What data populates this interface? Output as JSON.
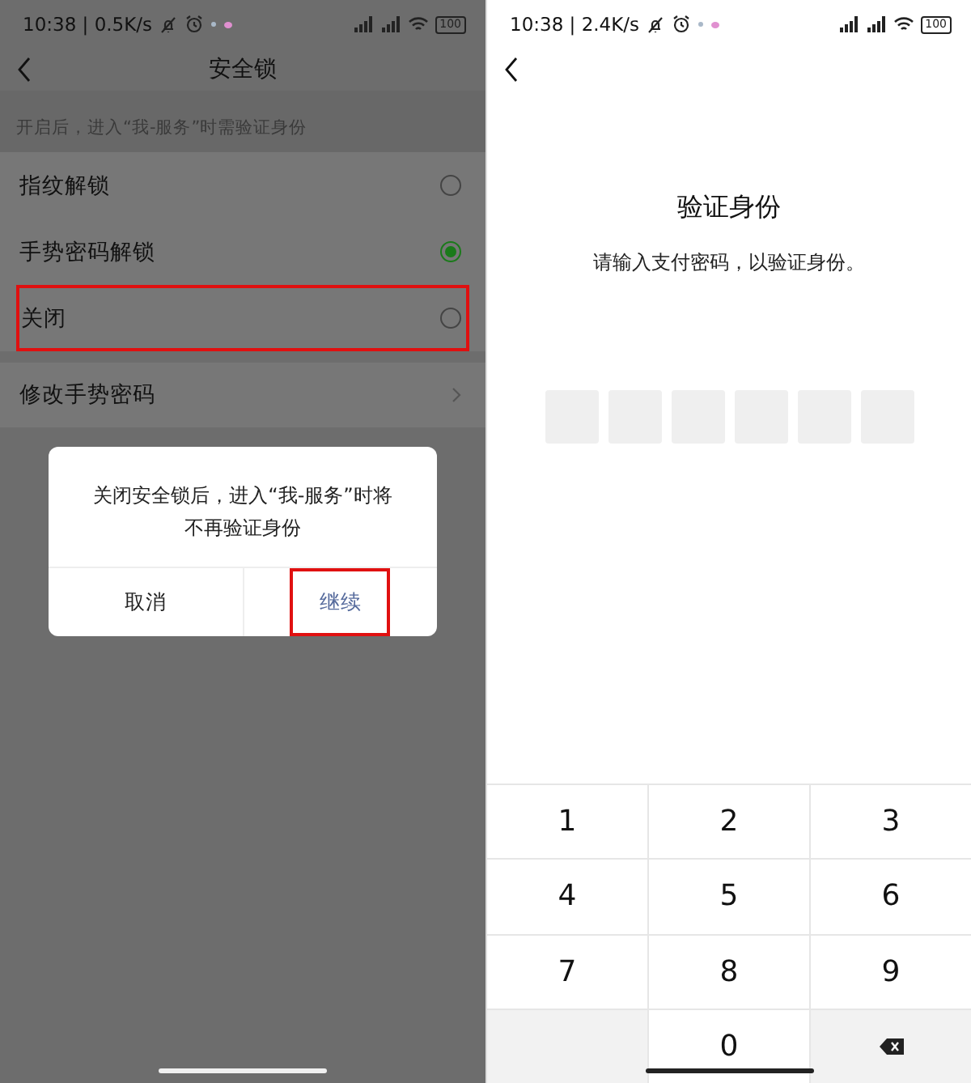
{
  "left_screen": {
    "status_bar": {
      "time": "10:38 | 0.5K/s",
      "battery": "100"
    },
    "title": "安全锁",
    "hint": "开启后，进入“我-服务”时需验证身份",
    "options": [
      {
        "kind": "radio",
        "label": "指纹解锁",
        "selected": false,
        "highlighted": false
      },
      {
        "kind": "radio",
        "label": "手势密码解锁",
        "selected": true,
        "highlighted": false
      },
      {
        "kind": "radio",
        "label": "关闭",
        "selected": false,
        "highlighted": true
      }
    ],
    "links": [
      {
        "label": "修改手势密码"
      }
    ],
    "dialog": {
      "message": "关闭安全锁后，进入“我-服务”时将不再验证身份",
      "buttons": [
        {
          "label": "取消",
          "kind": "cancel",
          "highlighted": false
        },
        {
          "label": "继续",
          "kind": "confirm",
          "highlighted": true
        }
      ]
    }
  },
  "right_screen": {
    "status_bar": {
      "time": "10:38 | 2.4K/s",
      "battery": "100"
    },
    "title": "验证身份",
    "subtitle": "请输入支付密码，以验证身份。",
    "pin_boxes": [
      {
        "filled": false
      },
      {
        "filled": false
      },
      {
        "filled": false
      },
      {
        "filled": false
      },
      {
        "filled": false
      },
      {
        "filled": false
      }
    ],
    "keypad": [
      {
        "kind": "digit",
        "label": "1"
      },
      {
        "kind": "digit",
        "label": "2"
      },
      {
        "kind": "digit",
        "label": "3"
      },
      {
        "kind": "digit",
        "label": "4"
      },
      {
        "kind": "digit",
        "label": "5"
      },
      {
        "kind": "digit",
        "label": "6"
      },
      {
        "kind": "digit",
        "label": "7"
      },
      {
        "kind": "digit",
        "label": "8"
      },
      {
        "kind": "digit",
        "label": "9"
      },
      {
        "kind": "blank"
      },
      {
        "kind": "digit",
        "label": "0"
      },
      {
        "kind": "delete"
      }
    ]
  }
}
